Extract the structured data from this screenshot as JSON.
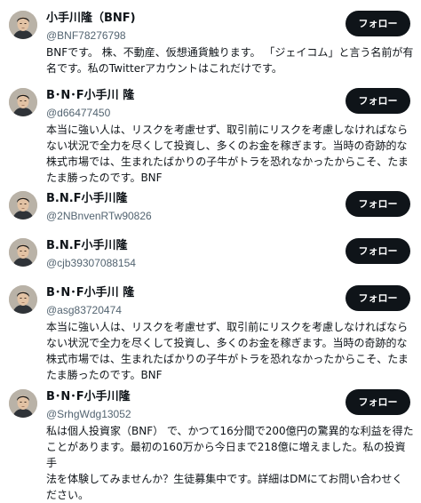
{
  "follow_label": "フォロー",
  "users": [
    {
      "name": "小手川隆（BNF)",
      "handle": "@BNF78276798",
      "bio": "BNFです。 株、不動産、仮想通貨触ります。 「ジェイコム」と言う名前が有\n名です。私のTwitterアカウントはこれだけです。"
    },
    {
      "name": "B･N･F小手川 隆",
      "handle": "@d66477450",
      "bio": "本当に強い人は、リスクを考慮せず、取引前にリスクを考慮しなければなら\nない状況で全力を尽くして投資し、多くのお金を稼ぎます。当時の奇跡的な\n株式市場では、生まれたばかりの子牛がトラを恐れなかったからこそ、たま\nたま勝ったのです。BNF"
    },
    {
      "name": "B.N.F小手川隆",
      "handle": "@2NBnvenRTw90826",
      "bio": ""
    },
    {
      "name": "B.N.F小手川隆",
      "handle": "@cjb39307088154",
      "bio": ""
    },
    {
      "name": "B･N･F小手川 隆",
      "handle": "@asg83720474",
      "bio": "本当に強い人は、リスクを考慮せず、取引前にリスクを考慮しなければなら\nない状況で全力を尽くして投資し、多くのお金を稼ぎます。当時の奇跡的な\n株式市場では、生まれたばかりの子牛がトラを恐れなかったからこそ、たま\nたま勝ったのです。BNF"
    },
    {
      "name": "B･N･F小手川隆",
      "handle": "@SrhgWdg13052",
      "bio": "私は個人投資家（BNF） で、かつて16分間で200億円の驚異的な利益を得た\nことがあります。最初の160万から今日まで218億に増えました。私の投資手\n法を体験してみませんか？生徒募集中です。詳細はDMにてお問い合わせく\nださい。"
    }
  ]
}
